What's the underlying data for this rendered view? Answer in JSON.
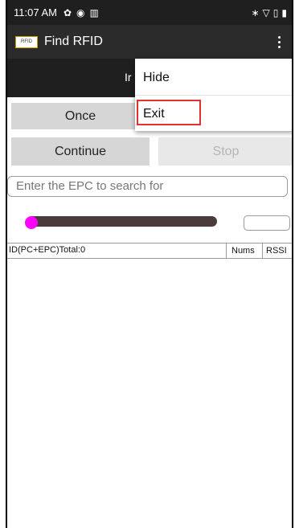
{
  "statusbar": {
    "time": "11:07 AM",
    "left_icons": [
      "gear-icon",
      "circle-icon",
      "sim-card-icon"
    ],
    "right_icons": [
      "bluetooth-icon",
      "wifi-icon",
      "sim-card-icon",
      "battery-icon"
    ]
  },
  "appbar": {
    "logo_text": "RFID",
    "title": "Find RFID"
  },
  "tabbar": {
    "label": "Ir"
  },
  "buttons": {
    "once": "Once",
    "continue": "Continue",
    "stop": "Stop"
  },
  "epc_input": {
    "placeholder": "Enter the EPC to search for",
    "value": ""
  },
  "table": {
    "header_id": "ID(PC+EPC)Total:0",
    "header_nums": "Nums",
    "header_rssi": "RSSI"
  },
  "menu": {
    "items": [
      {
        "label": "Hide"
      },
      {
        "label": "Exit"
      }
    ]
  },
  "colors": {
    "statusbar": "#1f1f1f",
    "appbar": "#2b2b2b",
    "slider_thumb": "#ff00ff",
    "slider_track": "#4a3b3d",
    "highlight": "#e0302f"
  }
}
